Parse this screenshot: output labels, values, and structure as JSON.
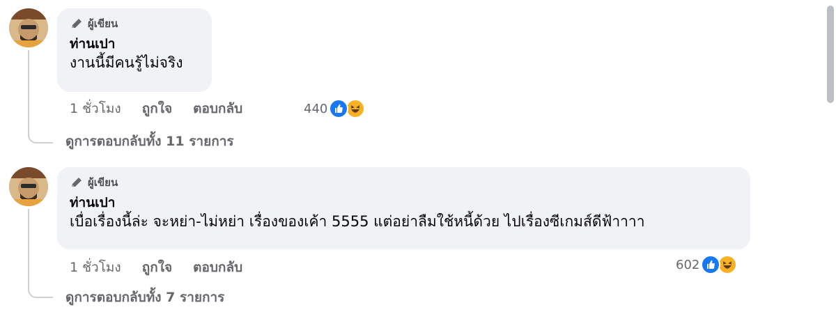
{
  "comments": [
    {
      "badge": "ผู้เขียน",
      "author": "ท่านเปา",
      "text": "งานนี้มีคนรู้ไม่จริง",
      "time": "1 ชั่วโมง",
      "like_label": "ถูกใจ",
      "reply_label": "ตอบกลับ",
      "reaction_count": "440",
      "view_replies": "ดูการตอบกลับทั้ง 11 รายการ"
    },
    {
      "badge": "ผู้เขียน",
      "author": "ท่านเปา",
      "text": "เบื่อเรื่องนี้ล่ะ จะหย่า-ไม่หย่า เรื่องของเค้า 5555 แต่อย่าลืมใช้หนี้ด้วย ไปเรื่องซีเกมส์ดีฟ้าาาา",
      "time": "1 ชั่วโมง",
      "like_label": "ถูกใจ",
      "reply_label": "ตอบกลับ",
      "reaction_count": "602",
      "view_replies": "ดูการตอบกลับทั้ง 7 รายการ"
    }
  ],
  "icons": {
    "badge": "pencil-icon",
    "reactions": [
      "like-icon",
      "haha-icon"
    ]
  },
  "colors": {
    "bubble": "#f0f2f5",
    "secondary_text": "#65676b",
    "like_blue": "#1877f2",
    "haha_yellow": "#f7b125"
  }
}
